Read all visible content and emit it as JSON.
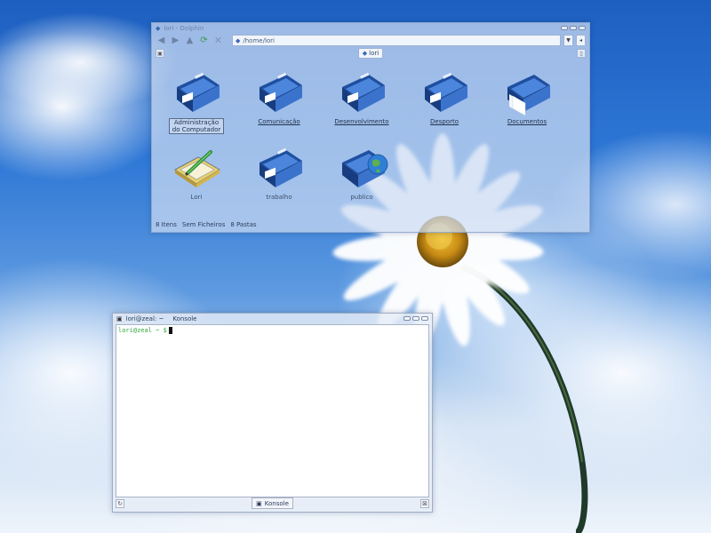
{
  "file_manager": {
    "title": "lori - Dolphin",
    "location": "/home/lori",
    "tab_label": "lori",
    "items": [
      {
        "label": "Administração do Computador",
        "icon": "blue-folder-icon"
      },
      {
        "label": "Comunicação",
        "icon": "blue-folder-icon"
      },
      {
        "label": "Desenvolvimento",
        "icon": "blue-folder-icon"
      },
      {
        "label": "Desporto",
        "icon": "blue-folder-icon"
      },
      {
        "label": "Documentos",
        "icon": "documents-folder-icon"
      },
      {
        "label": "Lori",
        "icon": "graphics-tablet-icon"
      },
      {
        "label": "trabalho",
        "icon": "blue-folder-icon"
      },
      {
        "label": "publico",
        "icon": "network-folder-icon"
      }
    ],
    "status": {
      "items": "8 Itens",
      "files": "Sem Ficheiros",
      "folders": "8 Pastas"
    }
  },
  "konsole": {
    "title": "lori@zeal: ~",
    "app_name": "Konsole",
    "prompt": "lori@zeal ~ $",
    "tab_label": "Konsole"
  },
  "colors": {
    "prompt_green": "#2fa83c",
    "folder_blue": "#2b5fb8"
  }
}
